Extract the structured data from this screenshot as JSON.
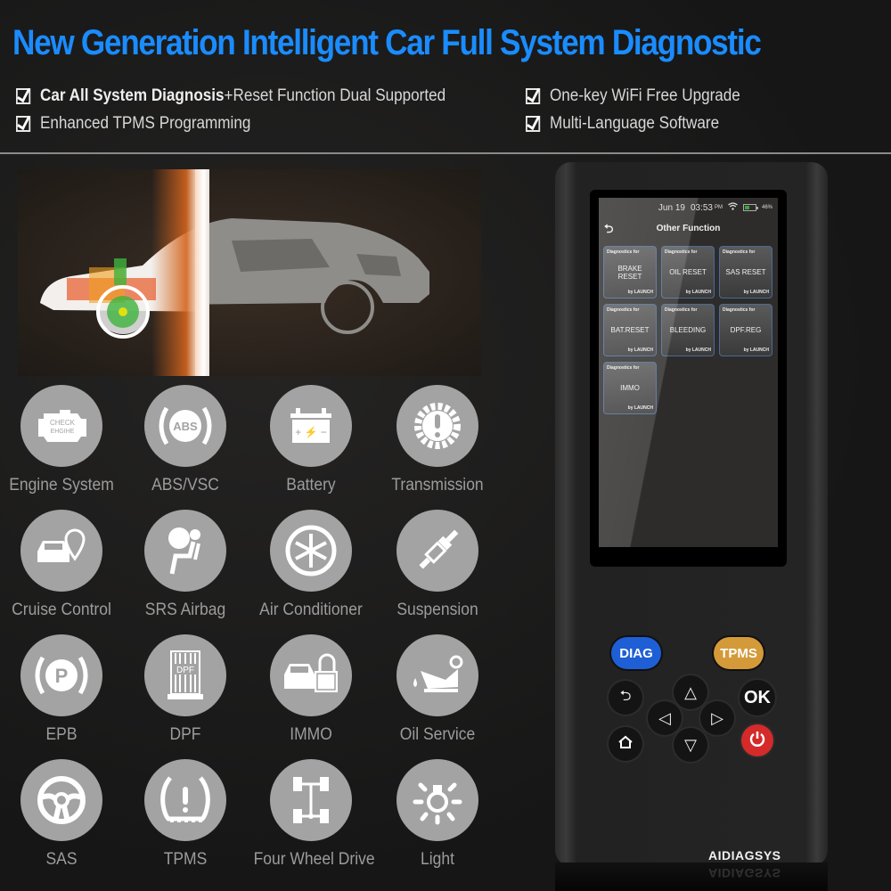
{
  "header": {
    "title": "New Generation Intelligent Car Full System Diagnostic",
    "features": [
      {
        "bold": "Car All System Diagnosis",
        "text": "+Reset Function Dual Supported"
      },
      {
        "bold": "",
        "text": "Enhanced TPMS Programming"
      },
      {
        "bold": "",
        "text": "One-key WiFi Free Upgrade"
      },
      {
        "bold": "",
        "text": "Multi-Language Software"
      }
    ]
  },
  "functions": [
    {
      "label": "Engine System",
      "icon": "check-engine-icon",
      "icon_text": [
        "CHECK",
        "EHGIHE"
      ]
    },
    {
      "label": "ABS/VSC",
      "icon": "abs-icon",
      "icon_text": [
        "ABS"
      ]
    },
    {
      "label": "Battery",
      "icon": "battery-icon"
    },
    {
      "label": "Transmission",
      "icon": "transmission-gear-icon"
    },
    {
      "label": "Cruise Control",
      "icon": "cruise-control-icon"
    },
    {
      "label": "SRS Airbag",
      "icon": "airbag-icon"
    },
    {
      "label": "Air Conditioner",
      "icon": "snowflake-icon"
    },
    {
      "label": "Suspension",
      "icon": "spark-plug-icon"
    },
    {
      "label": "EPB",
      "icon": "parking-brake-icon",
      "icon_text": [
        "P"
      ]
    },
    {
      "label": "DPF",
      "icon": "dpf-filter-icon",
      "icon_text": [
        "DPF"
      ]
    },
    {
      "label": "IMMO",
      "icon": "immobilizer-icon"
    },
    {
      "label": "Oil Service",
      "icon": "oil-can-icon"
    },
    {
      "label": "SAS",
      "icon": "steering-wheel-icon"
    },
    {
      "label": "TPMS",
      "icon": "tire-pressure-icon"
    },
    {
      "label": "Four Wheel Drive",
      "icon": "four-wheel-drive-icon"
    },
    {
      "label": "Light",
      "icon": "light-bulb-icon"
    }
  ],
  "device": {
    "brand": "AIDIAGSYS",
    "screen": {
      "date": "Jun 19",
      "time": "03:53",
      "ampm": "PM",
      "battery_pct": "46%",
      "battery_level": 0.46,
      "title": "Other Function",
      "tiles": [
        {
          "top": "Diagnostics for",
          "name": "BRAKE RESET",
          "by": "by LAUNCH"
        },
        {
          "top": "Diagnostics for",
          "name": "OIL RESET",
          "by": "by LAUNCH"
        },
        {
          "top": "Diagnostics for",
          "name": "SAS RESET",
          "by": "by LAUNCH"
        },
        {
          "top": "Diagnostics for",
          "name": "BAT.RESET",
          "by": "by LAUNCH"
        },
        {
          "top": "Diagnostics for",
          "name": "BLEEDING",
          "by": "by LAUNCH"
        },
        {
          "top": "Diagnostics for",
          "name": "DPF.REG",
          "by": "by LAUNCH"
        },
        {
          "top": "Diagnostics for",
          "name": "IMMO",
          "by": "by LAUNCH"
        }
      ]
    },
    "buttons": {
      "diag": "DIAG",
      "tpms": "TPMS",
      "ok": "OK"
    },
    "colors": {
      "diag": "#1e5fd6",
      "tpms": "#d49a3a",
      "power": "#d42a2a",
      "title": "#1a8cff"
    }
  }
}
